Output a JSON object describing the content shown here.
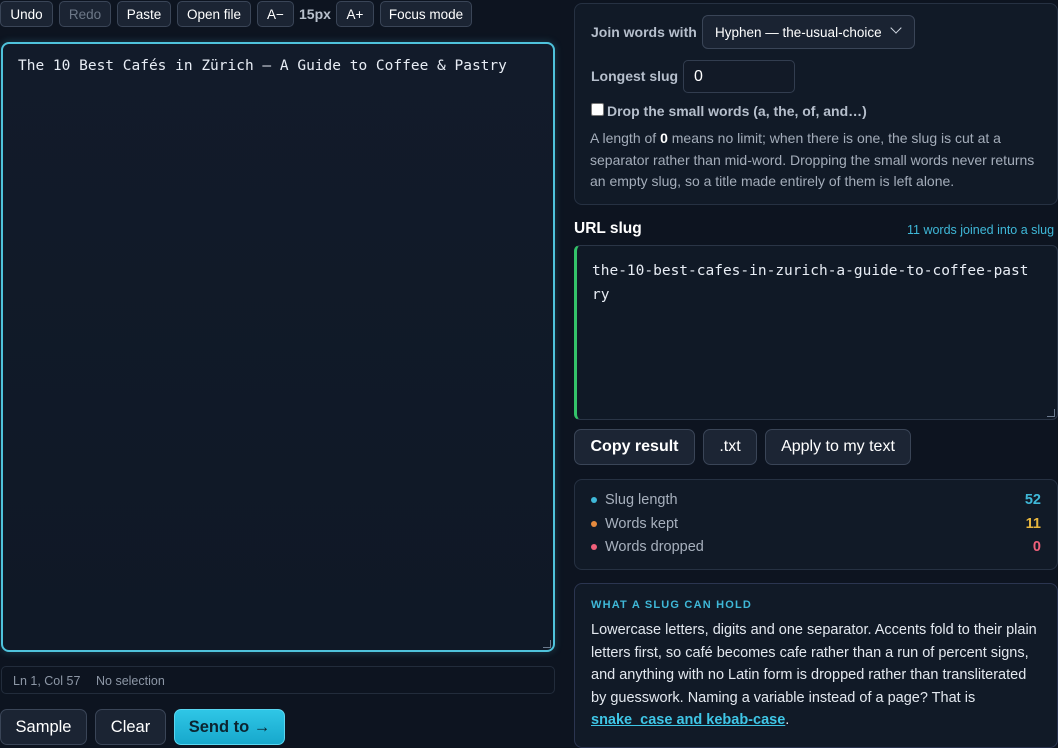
{
  "toolbar": {
    "undo": "Undo",
    "redo": "Redo",
    "paste": "Paste",
    "open_file": "Open file",
    "font_smaller": "A−",
    "font_size": "15px",
    "font_larger": "A+",
    "focus_mode": "Focus mode"
  },
  "editor": {
    "text": "The 10 Best Cafés in Zürich — A Guide to Coffee & Pastry"
  },
  "status": {
    "position": "Ln 1, Col 57",
    "selection": "No selection"
  },
  "actions": {
    "sample": "Sample",
    "clear": "Clear",
    "send": "Send to →"
  },
  "options": {
    "join_label": "Join words with",
    "join_value": "Hyphen — the-usual-choice",
    "longest_label": "Longest slug",
    "longest_value": "0",
    "drop_label": "Drop the small words (a, the, of, and…)",
    "drop_checked": false,
    "note_prefix": "A length of ",
    "note_bold": "0",
    "note_rest": " means no limit; when there is one, the slug is cut at a separator rather than mid-word. Dropping the small words never returns an empty slug, so a title made entirely of them is left alone."
  },
  "result": {
    "title": "URL slug",
    "count_label": "11 words joined into a slug",
    "slug": "the-10-best-cafes-in-zurich-a-guide-to-coffee-pastry",
    "copy": "Copy result",
    "txt": ".txt",
    "apply": "Apply to my text"
  },
  "stats": [
    {
      "label": "Slug length",
      "value": "52",
      "color": "#3fb8d8"
    },
    {
      "label": "Words kept",
      "value": "11",
      "color": "#e6b53e"
    },
    {
      "label": "Words dropped",
      "value": "0",
      "color": "#f0607a"
    }
  ],
  "info": {
    "title": "WHAT A SLUG CAN HOLD",
    "body": "Lowercase letters, digits and one separator. Accents fold to their plain letters first, so café becomes cafe rather than a run of percent signs, and anything with no Latin form is dropped rather than transliterated by guesswork. Naming a variable instead of a page? That is ",
    "link": "snake_case and kebab-case",
    "end": "."
  },
  "colors": {
    "accent": "#3fb8d8",
    "editor_border": "#4fc3dc",
    "slug_accent": "#34c36a",
    "primary_button": "#1fb5d8"
  }
}
